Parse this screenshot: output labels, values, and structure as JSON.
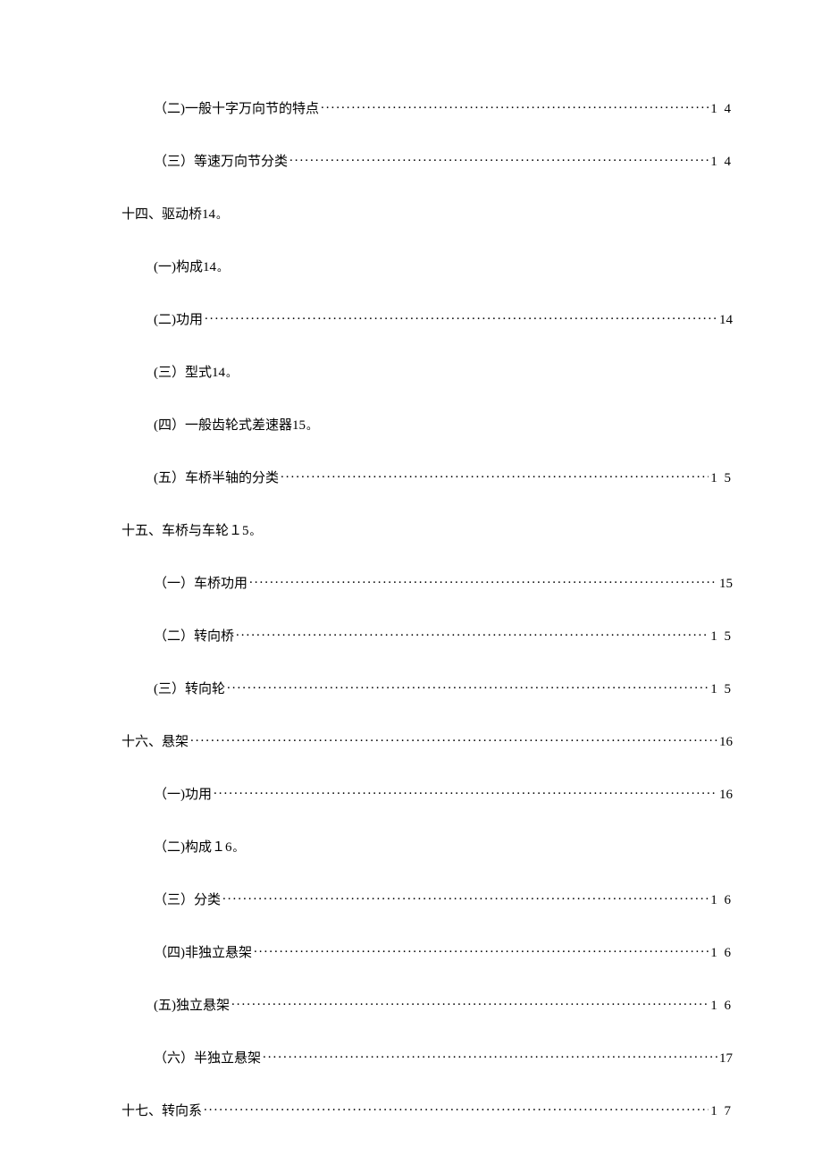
{
  "toc": [
    {
      "type": "leader",
      "indent": 1,
      "title": "（二)一般十字万向节的特点",
      "page": "1 4"
    },
    {
      "type": "leader",
      "indent": 1,
      "title": "（三）等速万向节分类",
      "page": "1 4"
    },
    {
      "type": "noleader",
      "indent": 0,
      "title": "十四、驱动桥14",
      "marker": "。"
    },
    {
      "type": "noleader",
      "indent": 1,
      "title": "(一)构成14",
      "marker": "。"
    },
    {
      "type": "leader",
      "indent": 1,
      "title": "(二)功用",
      "page": "14",
      "compact": true
    },
    {
      "type": "noleader",
      "indent": 1,
      "title": "(三）型式14",
      "marker": "。"
    },
    {
      "type": "noleader",
      "indent": 1,
      "title": "(四）一般齿轮式差速器15",
      "marker": "。"
    },
    {
      "type": "leader",
      "indent": 1,
      "title": "(五）车桥半轴的分类",
      "page": "1  5"
    },
    {
      "type": "noleader",
      "indent": 0,
      "title": "十五、车桥与车轮１5",
      "marker": "。"
    },
    {
      "type": "leader",
      "indent": 1,
      "title": "（一）车桥功用",
      "page": "15",
      "compact": true
    },
    {
      "type": "leader",
      "indent": 1,
      "title": "（二）转向桥",
      "page": "1 5"
    },
    {
      "type": "leader",
      "indent": 1,
      "title": "(三）转向轮",
      "page": "1  5"
    },
    {
      "type": "leader",
      "indent": 0,
      "title": "十六、悬架",
      "page": "16",
      "compact": true
    },
    {
      "type": "leader",
      "indent": 1,
      "title": "（一)功用",
      "page": "16",
      "compact": true
    },
    {
      "type": "noleader",
      "indent": 1,
      "title": "（二)构成１6",
      "marker": "。"
    },
    {
      "type": "leader",
      "indent": 1,
      "title": "（三）分类",
      "page": "1  6"
    },
    {
      "type": "leader",
      "indent": 1,
      "title": "（四)非独立悬架",
      "page": "1 6"
    },
    {
      "type": "leader",
      "indent": 1,
      "title": "(五)独立悬架",
      "page": "1  6"
    },
    {
      "type": "leader",
      "indent": 1,
      "title": "（六）半独立悬架",
      "page": "17",
      "compact": true
    },
    {
      "type": "leader",
      "indent": 0,
      "title": "十七、转向系",
      "page": "1 7"
    }
  ]
}
